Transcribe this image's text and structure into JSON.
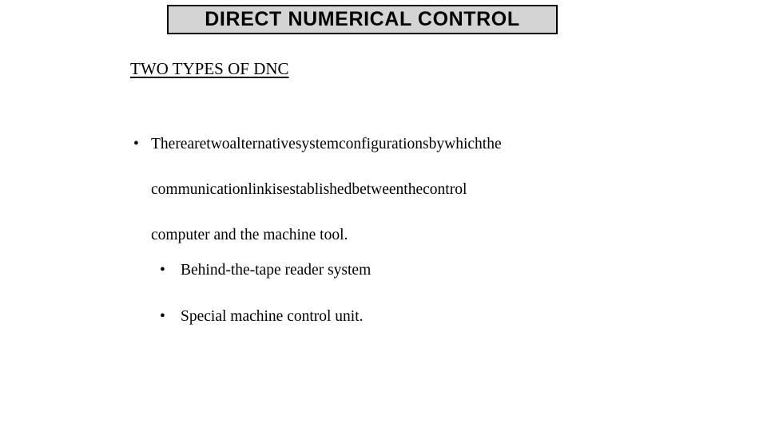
{
  "slide": {
    "title": "DIRECT NUMERICAL CONTROL",
    "heading": "TWO TYPES OF DNC",
    "bullet_marker": "•",
    "main_bullet": {
      "line1_words": [
        "There",
        "are",
        "two",
        "alternative",
        "system",
        "configurations",
        "by",
        "which",
        "the"
      ],
      "line2_words": [
        "communication",
        "link",
        "is",
        "established",
        "between",
        "the",
        "control"
      ],
      "line3": "computer and the machine tool.",
      "full_text": "There are two alternative system configurations by which the communication link is established between the control computer and the machine tool."
    },
    "sub_bullets": [
      {
        "text": "Behind-the-tape reader system"
      },
      {
        "text": "Special machine control unit."
      }
    ],
    "colors": {
      "background": "#ffffff",
      "text": "#000000",
      "title_fill": "#d4d4d4",
      "title_border": "#000000"
    }
  }
}
